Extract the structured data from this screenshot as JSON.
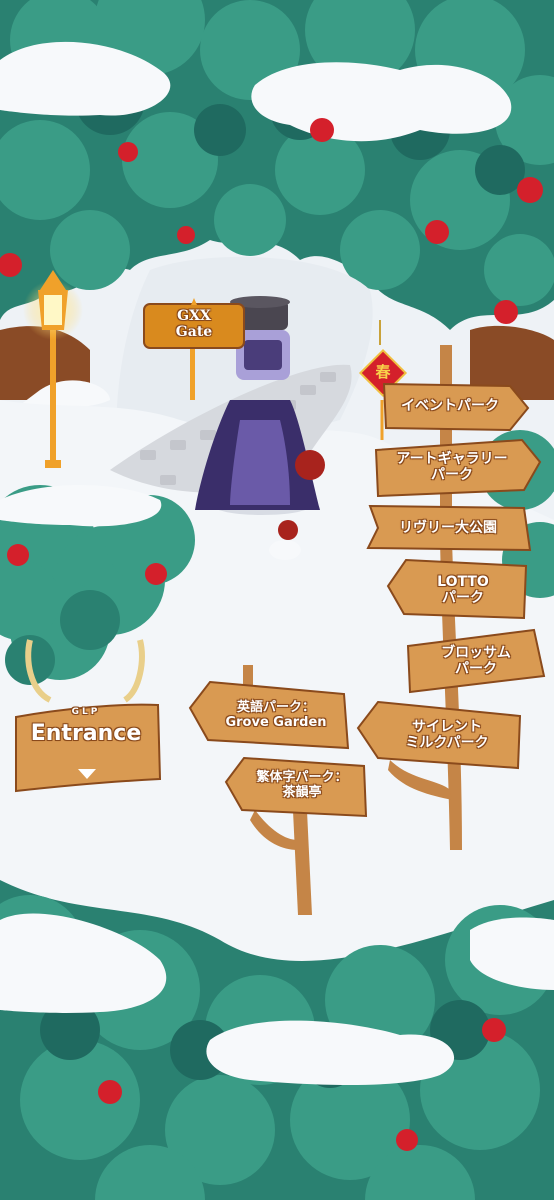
{
  "colors": {
    "snow": "#f7f9fb",
    "snow_shade": "#dfe6ee",
    "tree_dark": "#1f6d63",
    "tree_mid": "#2e8a78",
    "tree_light": "#3aa08c",
    "wood": "#d99a52",
    "wood_dark": "#a2612c",
    "apple": "#d4202b",
    "gold": "#f0a12a"
  },
  "gate_sign": {
    "line1": "GXX",
    "line2": "Gate",
    "icon": "star-icon"
  },
  "lantern_charm": {
    "text": "春"
  },
  "entrance_sign": {
    "top_text": "GLP",
    "label": "Entrance",
    "icon": "down-arrow-icon"
  },
  "signposts": {
    "right": [
      {
        "line1": "イベントパーク",
        "line2": ""
      },
      {
        "line1": "アートギャラリー",
        "line2": "パーク"
      },
      {
        "line1": "リヴリー大公園",
        "line2": ""
      },
      {
        "line1": "LOTTO",
        "line2": "パーク"
      },
      {
        "line1": "ブロッサム",
        "line2": "パーク"
      },
      {
        "line1": "サイレント",
        "line2": "ミルクパーク"
      }
    ],
    "left": [
      {
        "line1": "英語パーク：",
        "line2": "Grove Garden"
      },
      {
        "line1": "繁体字パーク：",
        "line2": "茶韻亭"
      }
    ]
  }
}
